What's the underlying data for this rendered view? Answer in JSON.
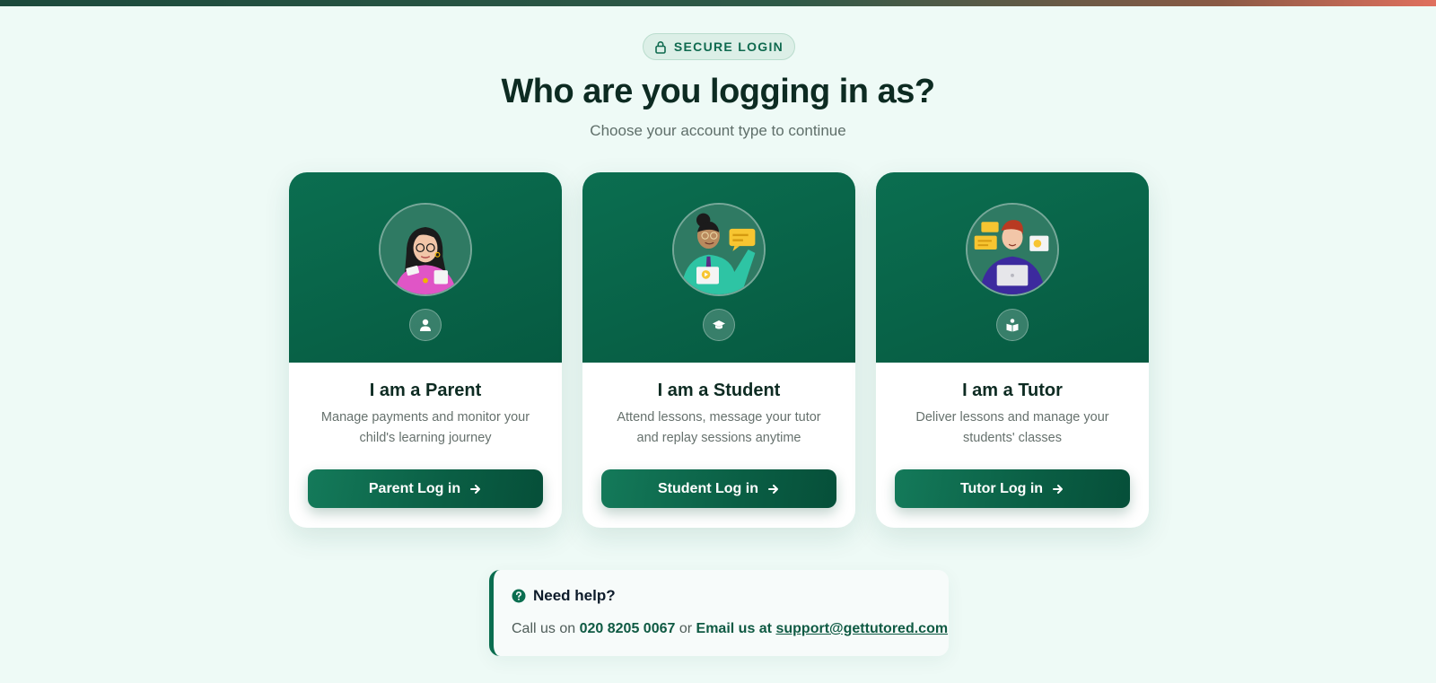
{
  "badge": {
    "icon": "lock-icon",
    "label": "SECURE LOGIN"
  },
  "heading": {
    "title": "Who are you logging in as?",
    "subtitle": "Choose your account type to continue"
  },
  "cards": [
    {
      "role_icon": "user-icon",
      "title": "I am a Parent",
      "description": "Manage payments and monitor your child's learning journey",
      "button_label": "Parent Log in"
    },
    {
      "role_icon": "graduation-cap-icon",
      "title": "I am a Student",
      "description": "Attend lessons, message your tutor and replay sessions anytime",
      "button_label": "Student Log in"
    },
    {
      "role_icon": "book-reader-icon",
      "title": "I am a Tutor",
      "description": "Deliver lessons and manage your students' classes",
      "button_label": "Tutor Log in"
    }
  ],
  "help": {
    "icon": "question-circle-icon",
    "title": "Need help?",
    "call_prefix": "Call us on",
    "phone": "020 8205 0067",
    "or_text": "or",
    "email_label": "Email us at",
    "email": "support@gettutored.com"
  },
  "colors": {
    "brand": "#0b6e50",
    "brand_dark": "#065a41",
    "background": "#eefaf6",
    "accent_bar_end": "#e0705e"
  }
}
